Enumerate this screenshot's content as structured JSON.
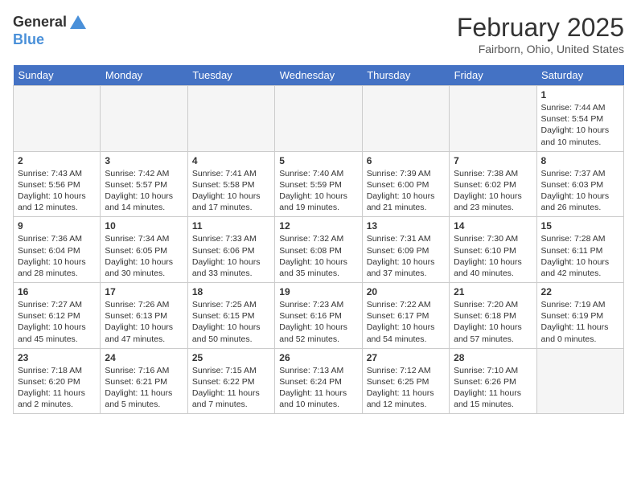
{
  "header": {
    "logo_general": "General",
    "logo_blue": "Blue",
    "title": "February 2025",
    "location": "Fairborn, Ohio, United States"
  },
  "days_of_week": [
    "Sunday",
    "Monday",
    "Tuesday",
    "Wednesday",
    "Thursday",
    "Friday",
    "Saturday"
  ],
  "weeks": [
    [
      {
        "day": "",
        "info": ""
      },
      {
        "day": "",
        "info": ""
      },
      {
        "day": "",
        "info": ""
      },
      {
        "day": "",
        "info": ""
      },
      {
        "day": "",
        "info": ""
      },
      {
        "day": "",
        "info": ""
      },
      {
        "day": "1",
        "info": "Sunrise: 7:44 AM\nSunset: 5:54 PM\nDaylight: 10 hours and 10 minutes."
      }
    ],
    [
      {
        "day": "2",
        "info": "Sunrise: 7:43 AM\nSunset: 5:56 PM\nDaylight: 10 hours and 12 minutes."
      },
      {
        "day": "3",
        "info": "Sunrise: 7:42 AM\nSunset: 5:57 PM\nDaylight: 10 hours and 14 minutes."
      },
      {
        "day": "4",
        "info": "Sunrise: 7:41 AM\nSunset: 5:58 PM\nDaylight: 10 hours and 17 minutes."
      },
      {
        "day": "5",
        "info": "Sunrise: 7:40 AM\nSunset: 5:59 PM\nDaylight: 10 hours and 19 minutes."
      },
      {
        "day": "6",
        "info": "Sunrise: 7:39 AM\nSunset: 6:00 PM\nDaylight: 10 hours and 21 minutes."
      },
      {
        "day": "7",
        "info": "Sunrise: 7:38 AM\nSunset: 6:02 PM\nDaylight: 10 hours and 23 minutes."
      },
      {
        "day": "8",
        "info": "Sunrise: 7:37 AM\nSunset: 6:03 PM\nDaylight: 10 hours and 26 minutes."
      }
    ],
    [
      {
        "day": "9",
        "info": "Sunrise: 7:36 AM\nSunset: 6:04 PM\nDaylight: 10 hours and 28 minutes."
      },
      {
        "day": "10",
        "info": "Sunrise: 7:34 AM\nSunset: 6:05 PM\nDaylight: 10 hours and 30 minutes."
      },
      {
        "day": "11",
        "info": "Sunrise: 7:33 AM\nSunset: 6:06 PM\nDaylight: 10 hours and 33 minutes."
      },
      {
        "day": "12",
        "info": "Sunrise: 7:32 AM\nSunset: 6:08 PM\nDaylight: 10 hours and 35 minutes."
      },
      {
        "day": "13",
        "info": "Sunrise: 7:31 AM\nSunset: 6:09 PM\nDaylight: 10 hours and 37 minutes."
      },
      {
        "day": "14",
        "info": "Sunrise: 7:30 AM\nSunset: 6:10 PM\nDaylight: 10 hours and 40 minutes."
      },
      {
        "day": "15",
        "info": "Sunrise: 7:28 AM\nSunset: 6:11 PM\nDaylight: 10 hours and 42 minutes."
      }
    ],
    [
      {
        "day": "16",
        "info": "Sunrise: 7:27 AM\nSunset: 6:12 PM\nDaylight: 10 hours and 45 minutes."
      },
      {
        "day": "17",
        "info": "Sunrise: 7:26 AM\nSunset: 6:13 PM\nDaylight: 10 hours and 47 minutes."
      },
      {
        "day": "18",
        "info": "Sunrise: 7:25 AM\nSunset: 6:15 PM\nDaylight: 10 hours and 50 minutes."
      },
      {
        "day": "19",
        "info": "Sunrise: 7:23 AM\nSunset: 6:16 PM\nDaylight: 10 hours and 52 minutes."
      },
      {
        "day": "20",
        "info": "Sunrise: 7:22 AM\nSunset: 6:17 PM\nDaylight: 10 hours and 54 minutes."
      },
      {
        "day": "21",
        "info": "Sunrise: 7:20 AM\nSunset: 6:18 PM\nDaylight: 10 hours and 57 minutes."
      },
      {
        "day": "22",
        "info": "Sunrise: 7:19 AM\nSunset: 6:19 PM\nDaylight: 11 hours and 0 minutes."
      }
    ],
    [
      {
        "day": "23",
        "info": "Sunrise: 7:18 AM\nSunset: 6:20 PM\nDaylight: 11 hours and 2 minutes."
      },
      {
        "day": "24",
        "info": "Sunrise: 7:16 AM\nSunset: 6:21 PM\nDaylight: 11 hours and 5 minutes."
      },
      {
        "day": "25",
        "info": "Sunrise: 7:15 AM\nSunset: 6:22 PM\nDaylight: 11 hours and 7 minutes."
      },
      {
        "day": "26",
        "info": "Sunrise: 7:13 AM\nSunset: 6:24 PM\nDaylight: 11 hours and 10 minutes."
      },
      {
        "day": "27",
        "info": "Sunrise: 7:12 AM\nSunset: 6:25 PM\nDaylight: 11 hours and 12 minutes."
      },
      {
        "day": "28",
        "info": "Sunrise: 7:10 AM\nSunset: 6:26 PM\nDaylight: 11 hours and 15 minutes."
      },
      {
        "day": "",
        "info": ""
      }
    ]
  ]
}
